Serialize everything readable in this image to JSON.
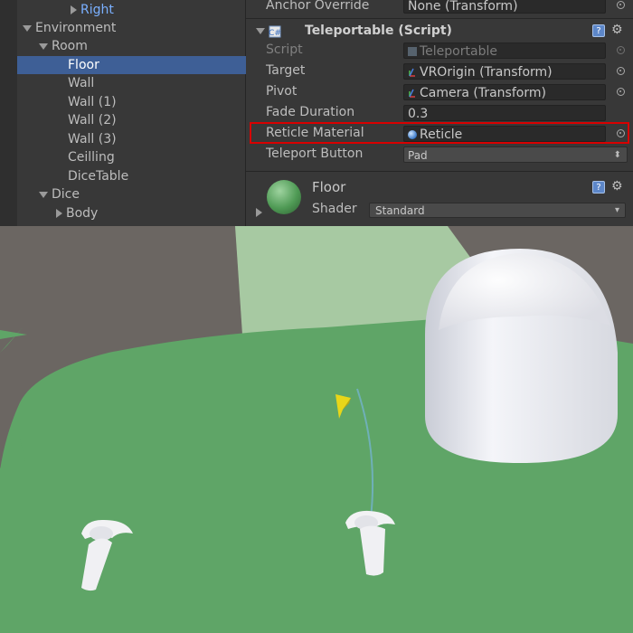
{
  "hierarchy": {
    "items": [
      {
        "label": "Right"
      },
      {
        "label": "Environment"
      },
      {
        "label": "Room"
      },
      {
        "label": "Floor"
      },
      {
        "label": "Wall"
      },
      {
        "label": "Wall (1)"
      },
      {
        "label": "Wall (2)"
      },
      {
        "label": "Wall (3)"
      },
      {
        "label": "Ceilling"
      },
      {
        "label": "DiceTable"
      },
      {
        "label": "Dice"
      },
      {
        "label": "Body"
      }
    ]
  },
  "inspector": {
    "anchor_override": {
      "label": "Anchor Override",
      "value": "None (Transform)"
    },
    "component": {
      "title": "Teleportable (Script)",
      "script": {
        "label": "Script",
        "value": "Teleportable"
      },
      "target": {
        "label": "Target",
        "value": "VROrigin (Transform)"
      },
      "pivot": {
        "label": "Pivot",
        "value": "Camera (Transform)"
      },
      "fade_duration": {
        "label": "Fade Duration",
        "value": "0.3"
      },
      "reticle_material": {
        "label": "Reticle Material",
        "value": "Reticle"
      },
      "teleport_button": {
        "label": "Teleport Button",
        "value": "Pad"
      }
    },
    "material": {
      "name": "Floor",
      "shader_label": "Shader",
      "shader_value": "Standard"
    }
  },
  "colors": {
    "highlight": "#d80000",
    "selection": "#3e5f96",
    "floor_green": "#5fa567",
    "pointer_yellow": "#e8d619"
  },
  "icons": [
    "help-icon",
    "gear-icon",
    "object-picker-icon",
    "script-icon",
    "transform-icon",
    "material-sphere-icon"
  ]
}
